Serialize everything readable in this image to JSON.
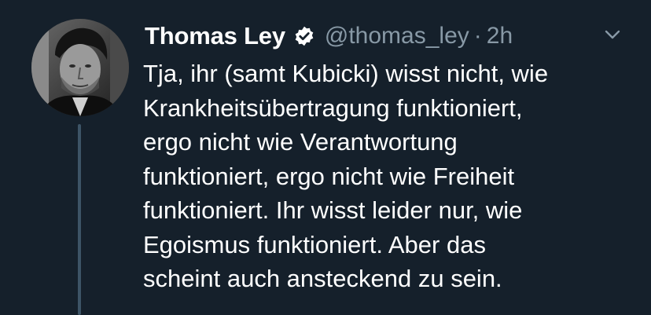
{
  "tweet": {
    "author": {
      "display_name": "Thomas Ley",
      "handle": "@thomas_ley",
      "verified": true
    },
    "separator": "·",
    "timestamp": "2h",
    "text_lines": [
      "Tja, ihr (samt Kubicki) wisst nicht, wie",
      "Krankheitsübertragung funktioniert,",
      "ergo nicht wie Verantwortung",
      "funktioniert, ergo nicht wie Freiheit",
      "funktioniert. Ihr wisst leider nur, wie",
      "Egoismus funktioniert. Aber das",
      "scheint auch ansteckend zu sein."
    ]
  },
  "icons": {
    "verified": "verified-badge-icon",
    "caret": "chevron-down-icon"
  },
  "colors": {
    "background": "#15202b",
    "text_primary": "#ffffff",
    "text_secondary": "#8899a6",
    "thread_line": "#3d5466"
  }
}
